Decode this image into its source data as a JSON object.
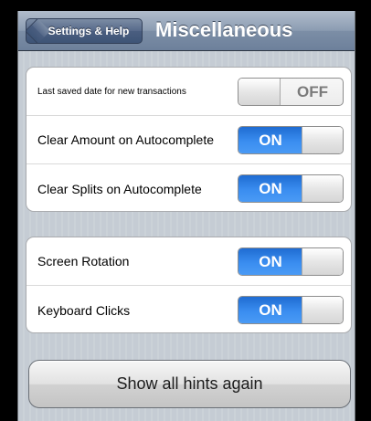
{
  "navbar": {
    "back_label": "Settings & Help",
    "title": "Miscellaneous"
  },
  "group1": {
    "rows": [
      {
        "label": "Last saved date for new transactions",
        "state": "OFF"
      },
      {
        "label": "Clear Amount on Autocomplete",
        "state": "ON"
      },
      {
        "label": "Clear Splits on Autocomplete",
        "state": "ON"
      }
    ]
  },
  "group2": {
    "rows": [
      {
        "label": "Screen Rotation",
        "state": "ON"
      },
      {
        "label": "Keyboard Clicks",
        "state": "ON"
      }
    ]
  },
  "hints_button": {
    "label": "Show all hints again"
  },
  "colors": {
    "switch_on": "#3a8df0",
    "navbar": "#7c8ea6",
    "background": "#c5ccd4"
  }
}
